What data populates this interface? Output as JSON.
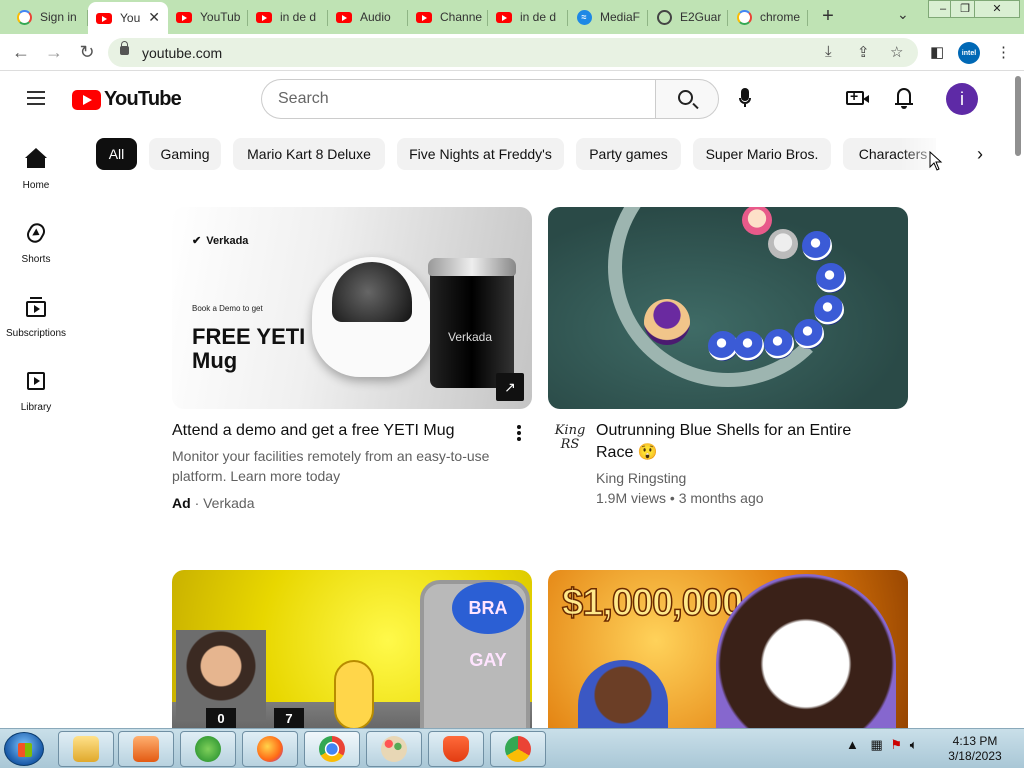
{
  "browser": {
    "tabs": [
      {
        "title": "Sign in",
        "favicon": "google-icon",
        "active": false
      },
      {
        "title": "You",
        "favicon": "youtube-icon",
        "active": true
      },
      {
        "title": "YouTub",
        "favicon": "youtube-icon",
        "active": false
      },
      {
        "title": "in de d",
        "favicon": "youtube-icon",
        "active": false
      },
      {
        "title": "Audio",
        "favicon": "youtube-icon",
        "active": false
      },
      {
        "title": "Channe",
        "favicon": "youtube-icon",
        "active": false
      },
      {
        "title": "in de d",
        "favicon": "youtube-icon",
        "active": false
      },
      {
        "title": "MediaF",
        "favicon": "mediafire-icon",
        "active": false
      },
      {
        "title": "E2Guar",
        "favicon": "globe-icon",
        "active": false
      },
      {
        "title": "chrome",
        "favicon": "google-icon",
        "active": false
      }
    ],
    "url": "youtube.com",
    "theme_color": "#bfe3b4"
  },
  "youtube": {
    "logo_text": "YouTube",
    "search_placeholder": "Search",
    "avatar_letter": "i",
    "avatar_color": "#5e2aa6",
    "guide": [
      {
        "label": "Home",
        "icon": "home-icon"
      },
      {
        "label": "Shorts",
        "icon": "shorts-icon"
      },
      {
        "label": "Subscriptions",
        "icon": "subscriptions-icon"
      },
      {
        "label": "Library",
        "icon": "library-icon"
      }
    ],
    "chips": [
      "All",
      "Gaming",
      "Mario Kart 8 Deluxe",
      "Five Nights at Freddy's",
      "Party games",
      "Super Mario Bros.",
      "Characters"
    ],
    "ad": {
      "brand_on_thumb": "Verkada",
      "thumb_small": "Book a Demo to get",
      "thumb_big": "FREE YETI Mug",
      "mug_label": "Verkada",
      "title": "Attend a demo and get a free YETI Mug",
      "description": "Monitor your facilities remotely from an easy-to-use platform. Learn more today",
      "ad_label": "Ad",
      "advertiser": "· Verkada"
    },
    "video1": {
      "title": "Outrunning Blue Shells for an Entire Race 😲",
      "channel": "King Ringsting",
      "meta": "1.9M views • 3 months ago",
      "avatar_text": "King RS"
    },
    "video2": {
      "thumb_logo": "BRA GAY",
      "scores": [
        "0",
        "7"
      ]
    },
    "video3": {
      "thumb_text": "$1,000,000"
    }
  },
  "taskbar": {
    "time": "4:13 PM",
    "date": "3/18/2023"
  }
}
